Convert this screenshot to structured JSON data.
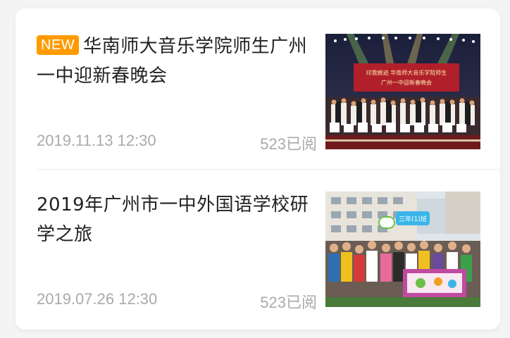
{
  "news_list": [
    {
      "badge": "NEW",
      "title": "华南师大音乐学院师生广州一中迎新春晚会",
      "time": "2019.11.13 12:30",
      "reads": "523已阅",
      "image_caption_lines": [
        "印我痕迹 华南师大音乐学院师生",
        "广州一中迎新春晚会"
      ]
    },
    {
      "title": "2019年广州市一中外国语学校研学之旅",
      "time": "2019.07.26 12:30",
      "reads": "523已阅",
      "image_sign": "三年(1)班"
    }
  ]
}
